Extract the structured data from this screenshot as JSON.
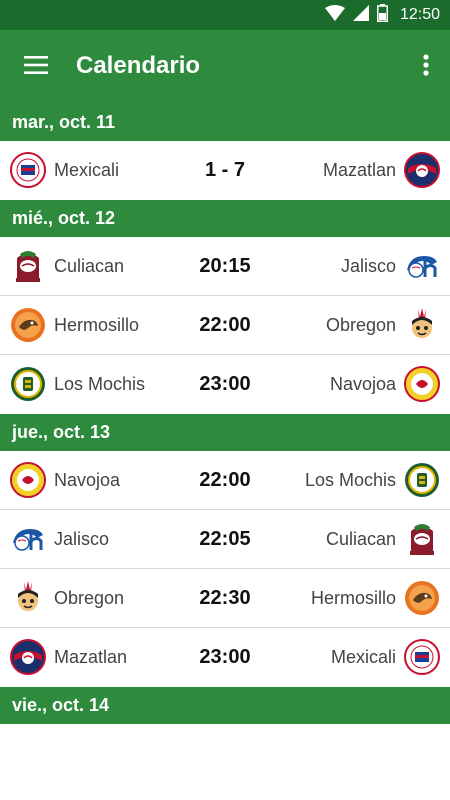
{
  "status_bar": {
    "time": "12:50"
  },
  "app_bar": {
    "title": "Calendario"
  },
  "colors": {
    "primary": "#2e8b3e",
    "status_bar": "#1b6b2c",
    "divider": "#d9d9d9"
  },
  "days": [
    {
      "label": "mar., oct. 11",
      "games": [
        {
          "home": "Mexicali",
          "home_logo": "mexicali-logo",
          "result": "1 - 7",
          "away": "Mazatlan",
          "away_logo": "mazatlan-logo"
        }
      ]
    },
    {
      "label": "mié., oct. 12",
      "games": [
        {
          "home": "Culiacan",
          "home_logo": "culiacan-logo",
          "result": "20:15",
          "away": "Jalisco",
          "away_logo": "jalisco-logo"
        },
        {
          "home": "Hermosillo",
          "home_logo": "hermosillo-logo",
          "result": "22:00",
          "away": "Obregon",
          "away_logo": "obregon-logo"
        },
        {
          "home": "Los Mochis",
          "home_logo": "los-mochis-logo",
          "result": "23:00",
          "away": "Navojoa",
          "away_logo": "navojoa-logo"
        }
      ]
    },
    {
      "label": "jue., oct. 13",
      "games": [
        {
          "home": "Navojoa",
          "home_logo": "navojoa-logo",
          "result": "22:00",
          "away": "Los Mochis",
          "away_logo": "los-mochis-logo"
        },
        {
          "home": "Jalisco",
          "home_logo": "jalisco-logo",
          "result": "22:05",
          "away": "Culiacan",
          "away_logo": "culiacan-logo"
        },
        {
          "home": "Obregon",
          "home_logo": "obregon-logo",
          "result": "22:30",
          "away": "Hermosillo",
          "away_logo": "hermosillo-logo"
        },
        {
          "home": "Mazatlan",
          "home_logo": "mazatlan-logo",
          "result": "23:00",
          "away": "Mexicali",
          "away_logo": "mexicali-logo"
        }
      ]
    },
    {
      "label": "vie., oct. 14",
      "games": []
    }
  ]
}
